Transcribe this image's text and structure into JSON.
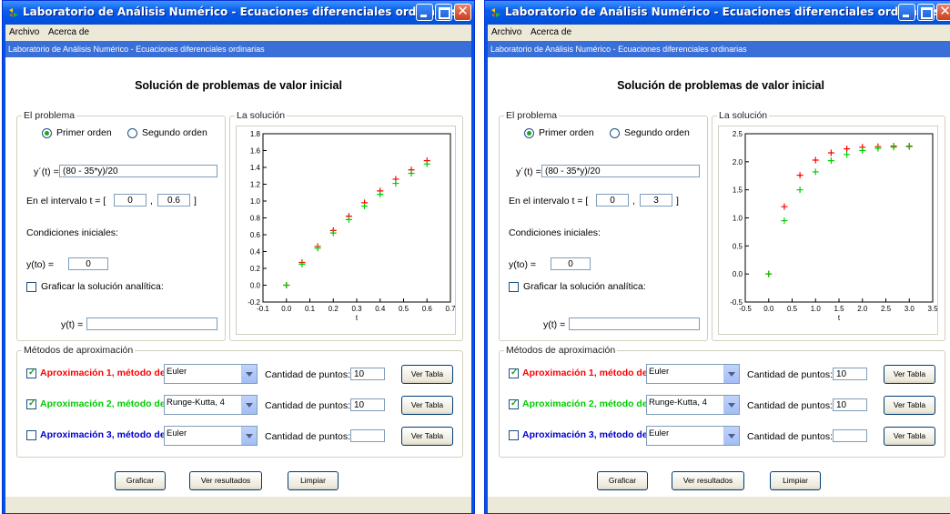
{
  "colors": {
    "approx1": "#ff0000",
    "approx2": "#00cc00",
    "approx3": "#0000cc",
    "radio_dot": "#21a121",
    "titlebar": "#0054e3"
  },
  "windows": [
    {
      "title": "Laboratorio de Análisis Numérico - Ecuaciones diferenciales ordinarias",
      "menu": {
        "archivo": "Archivo",
        "acerca": "Acerca de"
      },
      "app_header": "Laboratorio de Análisis Numérico - Ecuaciones diferenciales ordinarias",
      "heading": "Solución de problemas de valor inicial",
      "problem": {
        "legend": "El problema",
        "first_order": "Primer orden",
        "second_order": "Segundo orden",
        "selected": "first_order",
        "eq_label": "y´(t) =",
        "eq_value": "(80 - 35*y)/20",
        "interval_label": "En el intervalo t = [",
        "interval_sep": ",",
        "interval_close": "]",
        "t_start": "0",
        "t_end": "0.6",
        "initial_conditions": "Condiciones iniciales:",
        "y0_label": "y(to) =",
        "y0_value": "0",
        "analytic_label": "Graficar la solución analítica:",
        "analytic_checked": false,
        "yt_label": "y(t) =",
        "yt_value": ""
      },
      "solution": {
        "legend": "La solución"
      },
      "chart_data": {
        "type": "scatter",
        "xlabel": "t",
        "ylabel": "",
        "xlim": [
          -0.1,
          0.7
        ],
        "ylim": [
          -0.2,
          1.8
        ],
        "xticks": [
          "-0.1",
          "0.0",
          "0.1",
          "0.2",
          "0.3",
          "0.4",
          "0.5",
          "0.6",
          "0.7"
        ],
        "yticks": [
          "-0.2",
          "0.0",
          "0.2",
          "0.4",
          "0.6",
          "0.8",
          "1.0",
          "1.2",
          "1.4",
          "1.6",
          "1.8"
        ],
        "grid": false,
        "series": [
          {
            "color": "#ff0000",
            "marker": "+",
            "x": [
              0.0,
              0.0667,
              0.1333,
              0.2,
              0.2667,
              0.3333,
              0.4,
              0.4667,
              0.5333,
              0.6
            ],
            "y": [
              0.0,
              0.27,
              0.46,
              0.65,
              0.82,
              0.98,
              1.12,
              1.26,
              1.37,
              1.48
            ]
          },
          {
            "color": "#00cc00",
            "marker": "+",
            "x": [
              0.0,
              0.0667,
              0.1333,
              0.2,
              0.2667,
              0.3333,
              0.4,
              0.4667,
              0.5333,
              0.6
            ],
            "y": [
              0.0,
              0.25,
              0.44,
              0.62,
              0.78,
              0.94,
              1.08,
              1.21,
              1.33,
              1.44
            ]
          }
        ]
      },
      "methods": {
        "legend": "Métodos de aproximación",
        "rows": [
          {
            "label": "Aproximación 1, método de",
            "checked": true,
            "method": "Euler",
            "points_label": "Cantidad de puntos:",
            "points": "10",
            "table_button": "Ver Tabla",
            "color": "#ff0000"
          },
          {
            "label": "Aproximación 2, método de",
            "checked": true,
            "method": "Runge-Kutta, 4",
            "points_label": "Cantidad de puntos:",
            "points": "10",
            "table_button": "Ver Tabla",
            "color": "#00cc00"
          },
          {
            "label": "Aproximación 3, método de",
            "checked": false,
            "method": "Euler",
            "points_label": "Cantidad de puntos:",
            "points": "",
            "table_button": "Ver Tabla",
            "color": "#0000cc"
          }
        ]
      },
      "buttons": {
        "graficar": "Graficar",
        "ver_resultados": "Ver resultados",
        "limpiar": "Limpiar"
      }
    },
    {
      "title": "Laboratorio de Análisis Numérico - Ecuaciones diferenciales ordinarias",
      "menu": {
        "archivo": "Archivo",
        "acerca": "Acerca de"
      },
      "app_header": "Laboratorio de Análisis Numérico - Ecuaciones diferenciales ordinarias",
      "heading": "Solución de problemas de valor inicial",
      "problem": {
        "legend": "El problema",
        "first_order": "Primer orden",
        "second_order": "Segundo orden",
        "selected": "first_order",
        "eq_label": "y´(t) =",
        "eq_value": "(80 - 35*y)/20",
        "interval_label": "En el intervalo t = [",
        "interval_sep": ",",
        "interval_close": "]",
        "t_start": "0",
        "t_end": "3",
        "initial_conditions": "Condiciones iniciales:",
        "y0_label": "y(to) =",
        "y0_value": "0",
        "analytic_label": "Graficar la solución analítica:",
        "analytic_checked": false,
        "yt_label": "y(t) =",
        "yt_value": ""
      },
      "solution": {
        "legend": "La solución"
      },
      "chart_data": {
        "type": "scatter",
        "xlabel": "t",
        "ylabel": "",
        "xlim": [
          -0.5,
          3.5
        ],
        "ylim": [
          -0.5,
          2.5
        ],
        "xticks": [
          "-0.5",
          "0.0",
          "0.5",
          "1.0",
          "1.5",
          "2.0",
          "2.5",
          "3.0",
          "3.5"
        ],
        "yticks": [
          "-0.5",
          "0.0",
          "0.5",
          "1.0",
          "1.5",
          "2.0",
          "2.5"
        ],
        "grid": false,
        "series": [
          {
            "color": "#ff0000",
            "marker": "+",
            "x": [
              0.0,
              0.333,
              0.667,
              1.0,
              1.333,
              1.667,
              2.0,
              2.333,
              2.667,
              3.0
            ],
            "y": [
              0.0,
              1.2,
              1.76,
              2.03,
              2.16,
              2.23,
              2.26,
              2.27,
              2.28,
              2.28
            ]
          },
          {
            "color": "#00cc00",
            "marker": "+",
            "x": [
              0.0,
              0.333,
              0.667,
              1.0,
              1.333,
              1.667,
              2.0,
              2.333,
              2.667,
              3.0
            ],
            "y": [
              0.0,
              0.95,
              1.5,
              1.82,
              2.02,
              2.13,
              2.2,
              2.24,
              2.26,
              2.27
            ]
          }
        ]
      },
      "methods": {
        "legend": "Métodos de aproximación",
        "rows": [
          {
            "label": "Aproximación 1, método de",
            "checked": true,
            "method": "Euler",
            "points_label": "Cantidad de puntos:",
            "points": "10",
            "table_button": "Ver Tabla",
            "color": "#ff0000"
          },
          {
            "label": "Aproximación 2, método de",
            "checked": true,
            "method": "Runge-Kutta, 4",
            "points_label": "Cantidad de puntos:",
            "points": "10",
            "table_button": "Ver Tabla",
            "color": "#00cc00"
          },
          {
            "label": "Aproximación 3, método de",
            "checked": false,
            "method": "Euler",
            "points_label": "Cantidad de puntos:",
            "points": "",
            "table_button": "Ver Tabla",
            "color": "#0000cc"
          }
        ]
      },
      "buttons": {
        "graficar": "Graficar",
        "ver_resultados": "Ver resultados",
        "limpiar": "Limpiar"
      }
    }
  ]
}
